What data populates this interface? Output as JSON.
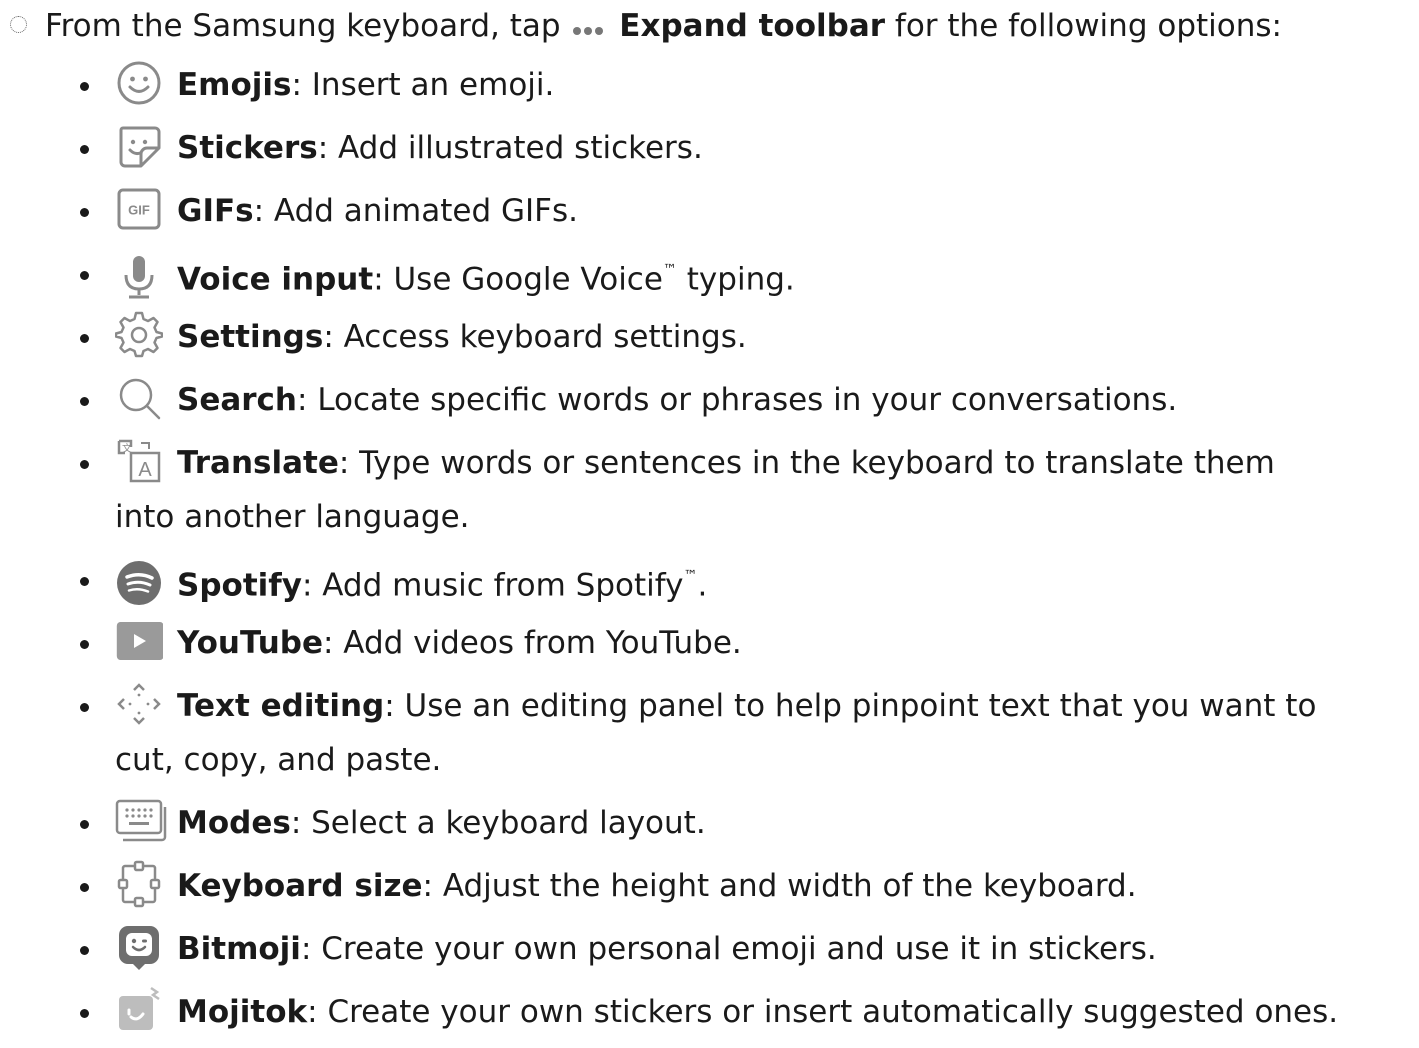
{
  "intro": {
    "prefix": "From the Samsung keyboard, tap",
    "emph": "Expand toolbar",
    "suffix": "for the following options:"
  },
  "items": [
    {
      "icon": "emoji-icon",
      "term": "Emojis",
      "desc": ": Insert an emoji."
    },
    {
      "icon": "sticker-icon",
      "term": "Stickers",
      "desc": ": Add illustrated stickers."
    },
    {
      "icon": "gif-icon",
      "term": "GIFs",
      "desc": ": Add animated GIFs."
    },
    {
      "icon": "microphone-icon",
      "term": "Voice input",
      "desc": ": Use Google Voice",
      "tm": "™",
      "desc2": " typing."
    },
    {
      "icon": "gear-icon",
      "term": "Settings",
      "desc": ": Access keyboard settings."
    },
    {
      "icon": "search-icon",
      "term": "Search",
      "desc": ": Locate specific words or phrases in your conversations."
    },
    {
      "icon": "translate-icon",
      "term": "Translate",
      "desc": ": Type words or sentences in the keyboard to translate them",
      "desc_line2": "into another language."
    },
    {
      "icon": "spotify-icon",
      "term": "Spotify",
      "desc": ": Add music from Spotify",
      "tm": "™",
      "desc2": "."
    },
    {
      "icon": "youtube-icon",
      "term": "YouTube",
      "desc": ": Add videos from YouTube."
    },
    {
      "icon": "text-editing-icon",
      "term": "Text editing",
      "desc": ": Use an editing panel to help pinpoint text that you want to",
      "desc_line2": "cut, copy, and paste."
    },
    {
      "icon": "keyboard-modes-icon",
      "term": "Modes",
      "desc": ": Select a keyboard layout."
    },
    {
      "icon": "keyboard-size-icon",
      "term": "Keyboard size",
      "desc": ": Adjust the height and width of the keyboard."
    },
    {
      "icon": "bitmoji-icon",
      "term": "Bitmoji",
      "desc": ": Create your own personal emoji and use it in stickers."
    },
    {
      "icon": "mojitok-icon",
      "term": "Mojitok",
      "desc": ": Create your own stickers or insert automatically suggested ones."
    }
  ],
  "colors": {
    "text": "#1a1a1a",
    "icon_gray": "#8a8a8a",
    "icon_dark": "#6e6e6e"
  }
}
